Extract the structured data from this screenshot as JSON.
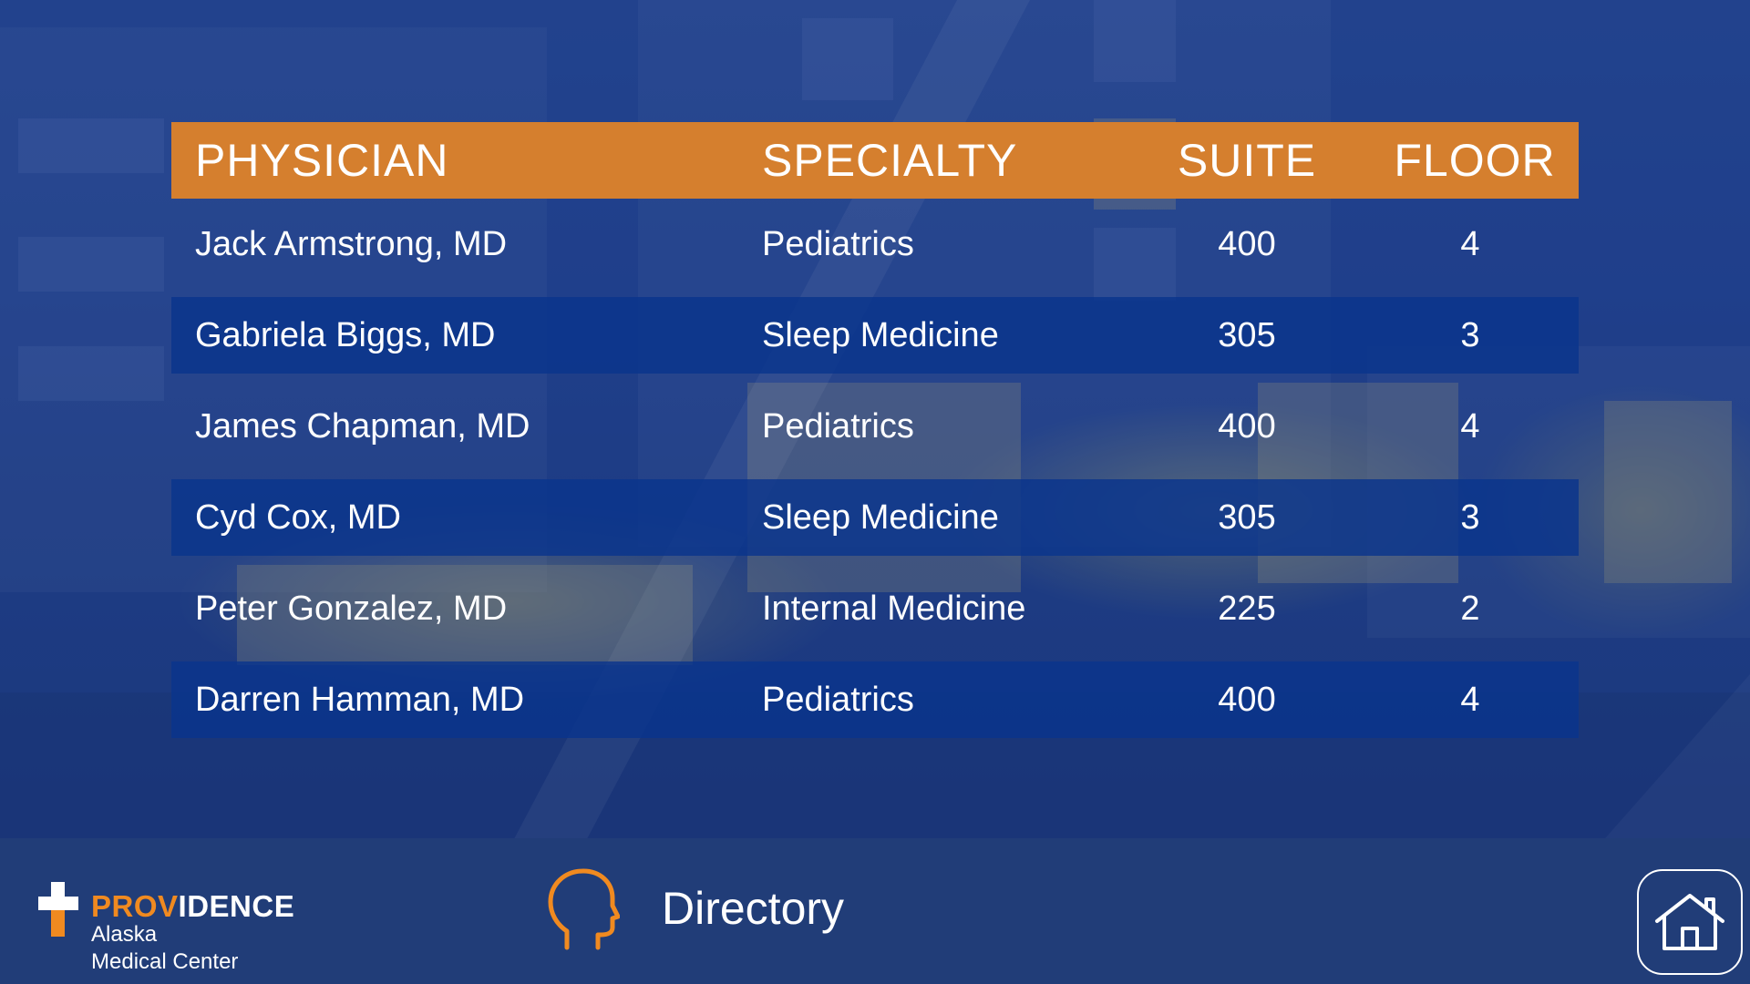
{
  "table": {
    "headers": {
      "physician": "PHYSICIAN",
      "specialty": "SPECIALTY",
      "suite": "SUITE",
      "floor": "FLOOR"
    },
    "rows": [
      {
        "physician": "Jack Armstrong, MD",
        "specialty": "Pediatrics",
        "suite": "400",
        "floor": "4"
      },
      {
        "physician": "Gabriela Biggs, MD",
        "specialty": "Sleep Medicine",
        "suite": "305",
        "floor": "3"
      },
      {
        "physician": "James Chapman, MD",
        "specialty": "Pediatrics",
        "suite": "400",
        "floor": "4"
      },
      {
        "physician": "Cyd Cox, MD",
        "specialty": "Sleep Medicine",
        "suite": "305",
        "floor": "3"
      },
      {
        "physician": "Peter Gonzalez, MD",
        "specialty": "Internal Medicine",
        "suite": "225",
        "floor": "2"
      },
      {
        "physician": "Darren Hamman, MD",
        "specialty": "Pediatrics",
        "suite": "400",
        "floor": "4"
      }
    ]
  },
  "footer": {
    "brand_orange": "PROV",
    "brand_white": "IDENCE",
    "brand_line2": "Alaska",
    "brand_line3": "Medical Center",
    "section_label": "Directory",
    "section_icon": "head-profile-icon",
    "home_icon": "home-icon"
  },
  "colors": {
    "accent_orange": "#d57f2e",
    "row_highlight": "#0a348c",
    "footer_bg": "#213d78"
  }
}
